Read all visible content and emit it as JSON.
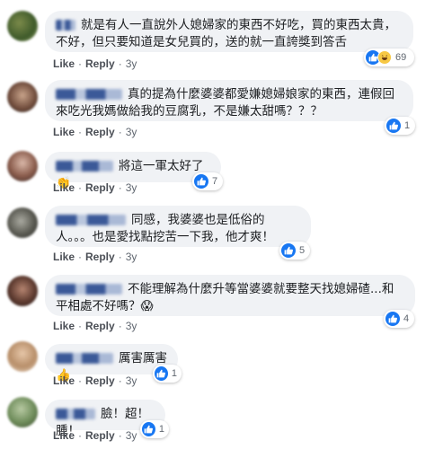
{
  "actions": {
    "like": "Like",
    "reply": "Reply",
    "sep": "·"
  },
  "colors": {
    "bubble_bg": "#f0f2f5",
    "like_blue": "#1877f2",
    "meta_gray": "#606770"
  },
  "comments": [
    {
      "author": "",
      "text": "就是有人一直說外人媳婦家的東西不好吃，買的東西太貴，不好，但只要知道是女兒買的，送的就一直誇獎到答舌",
      "time": "3y",
      "reaction_icons": [
        "like-icon",
        "haha-icon"
      ],
      "reaction_count": "69"
    },
    {
      "author": "",
      "text": "真的提為什麼婆婆都愛嫌媳婦娘家的東西，連假回來吃光我媽做給我的豆腐乳，不是嫌太甜嗎？？？",
      "time": "3y",
      "reaction_icons": [
        "like-icon"
      ],
      "reaction_count": "1"
    },
    {
      "author": "",
      "text": "將這一軍太好了👏",
      "time": "3y",
      "reaction_icons": [
        "like-icon"
      ],
      "reaction_count": "7"
    },
    {
      "author": "",
      "text": "同感，我婆婆也是低俗的人。。。也是愛找點挖苦一下我，他才爽！",
      "time": "3y",
      "reaction_icons": [
        "like-icon"
      ],
      "reaction_count": "5"
    },
    {
      "author": "",
      "text": "不能理解為什麼升等當婆婆就要整天找媳婦碴...和平相處不好嗎？😱",
      "time": "3y",
      "reaction_icons": [
        "like-icon"
      ],
      "reaction_count": "4"
    },
    {
      "author": "",
      "text": "厲害厲害👍",
      "time": "3y",
      "reaction_icons": [
        "like-icon"
      ],
      "reaction_count": "1"
    },
    {
      "author": "",
      "text": "臉！超！腫！",
      "time": "3y",
      "reaction_icons": [
        "like-icon"
      ],
      "reaction_count": "1"
    }
  ]
}
